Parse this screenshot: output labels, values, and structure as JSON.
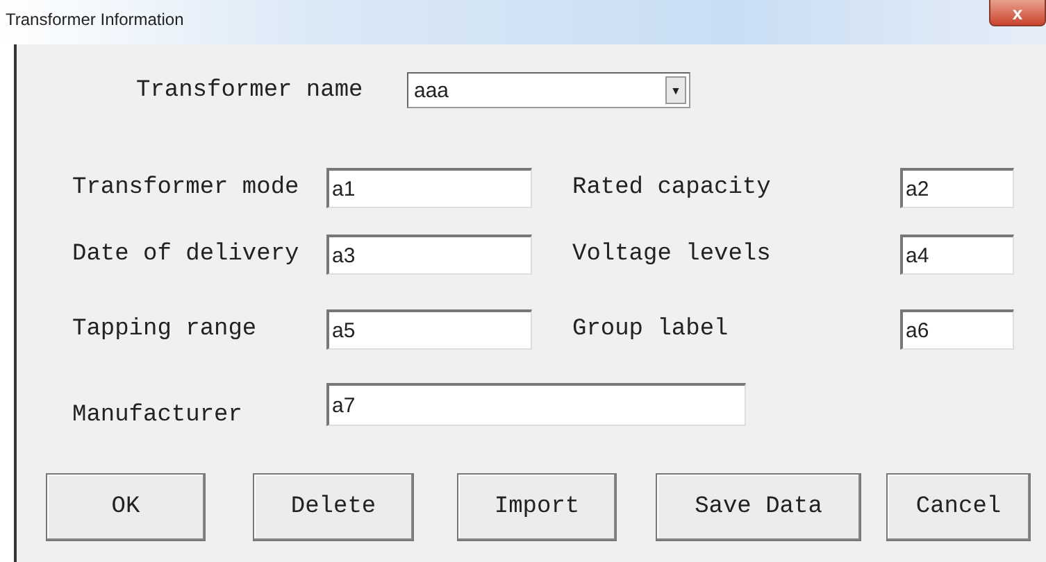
{
  "window": {
    "title": "Transformer Information",
    "close": "x"
  },
  "name_field": {
    "label": "Transformer name",
    "value": "aaa",
    "arrow": "▾"
  },
  "fields": [
    {
      "label": "Transformer mode",
      "value": "a1"
    },
    {
      "label": "Rated capacity",
      "value": "a2"
    },
    {
      "label": "Date of delivery",
      "value": "a3"
    },
    {
      "label": "Voltage levels",
      "value": "a4"
    },
    {
      "label": "Tapping range",
      "value": "a5"
    },
    {
      "label": "Group label",
      "value": "a6"
    }
  ],
  "manufacturer": {
    "label": "Manufacturer",
    "value": "a7"
  },
  "buttons": [
    "OK",
    "Delete",
    "Import",
    "Save Data",
    "Cancel"
  ]
}
